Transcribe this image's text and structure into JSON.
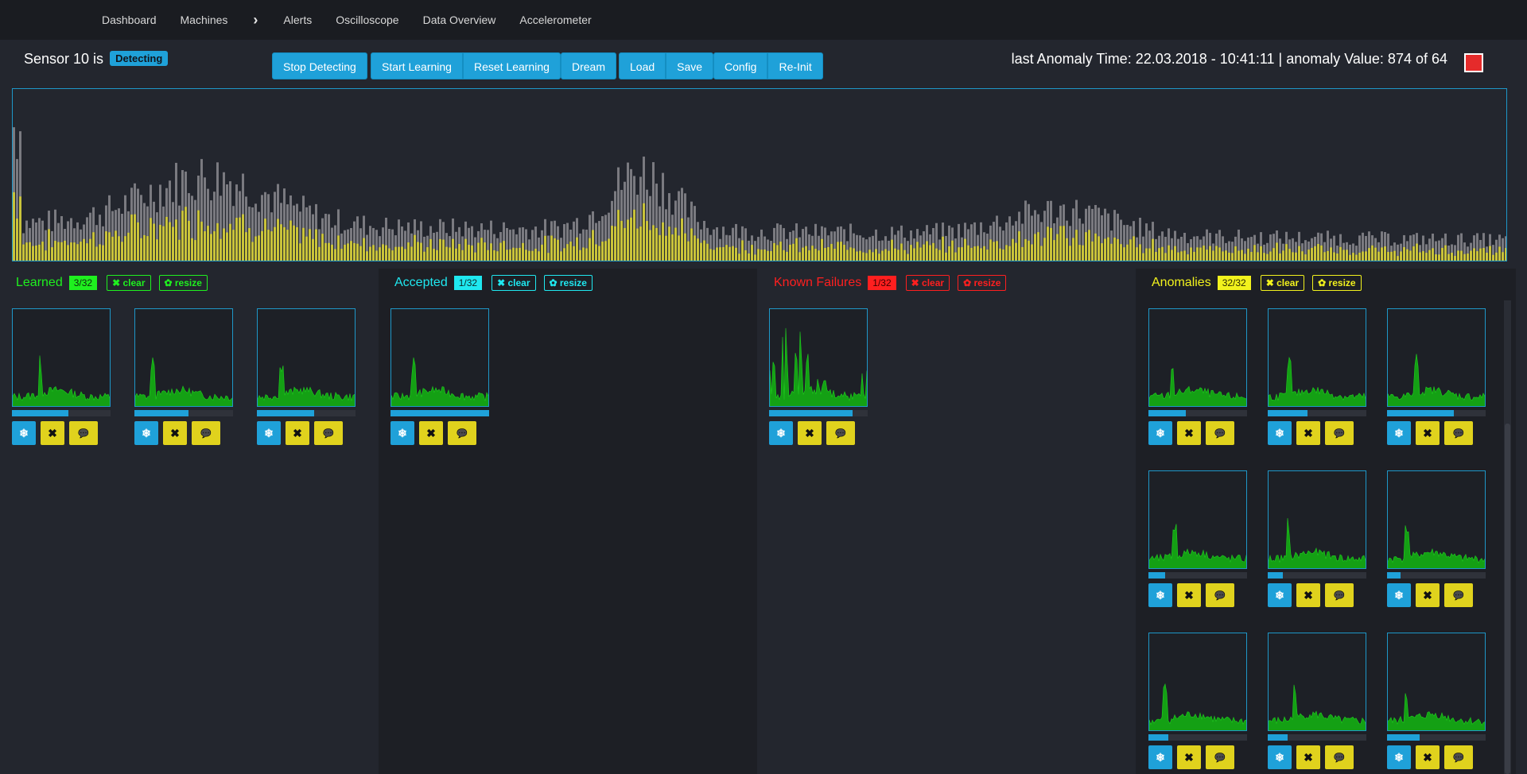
{
  "nav": {
    "items": [
      "Dashboard",
      "Machines"
    ],
    "chevron": "›",
    "items2": [
      "Alerts",
      "Oscilloscope",
      "Data Overview",
      "Accelerometer"
    ]
  },
  "status": {
    "prefix": "Sensor 10 is",
    "badge": "Detecting"
  },
  "buttons": {
    "stop_detecting": "Stop Detecting",
    "start_learning": "Start Learning",
    "reset_learning": "Reset Learning",
    "dream": "Dream",
    "load": "Load",
    "save": "Save",
    "config": "Config",
    "reinit": "Re-Init"
  },
  "anomaly": {
    "text": "last Anomaly Time: 22.03.2018 - 10:41:11 | anomaly Value: 874 of 64"
  },
  "colors": {
    "accent": "#1fa1d9",
    "learned": "#1ff01f",
    "accepted": "#1fe8f0",
    "failures": "#ff1f1f",
    "anomalies": "#f2f21d",
    "alarm": "#e52b2b"
  },
  "panels": {
    "learned": {
      "title": "Learned",
      "count": "3/32",
      "clear": "✖ clear",
      "resize": "✿ resize"
    },
    "accepted": {
      "title": "Accepted",
      "count": "1/32",
      "clear": "✖ clear",
      "resize": "✿ resize"
    },
    "failures": {
      "title": "Known Failures",
      "count": "1/32",
      "clear": "✖ clear",
      "resize": "✿ resize"
    },
    "anomalies": {
      "title": "Anomalies",
      "count": "32/32",
      "clear": "✖ clear",
      "resize": "✿ resize"
    }
  },
  "card_icons": {
    "freeze": "❄",
    "delete": "✖",
    "comment": "💬"
  },
  "progress": {
    "learned": [
      0.57,
      0.55,
      0.58
    ],
    "accepted": [
      1.0
    ],
    "failures": [
      0.85
    ],
    "anomalies": [
      0.38,
      0.4,
      0.68,
      0.17,
      0.15,
      0.14,
      0.2,
      0.2,
      0.33
    ]
  }
}
